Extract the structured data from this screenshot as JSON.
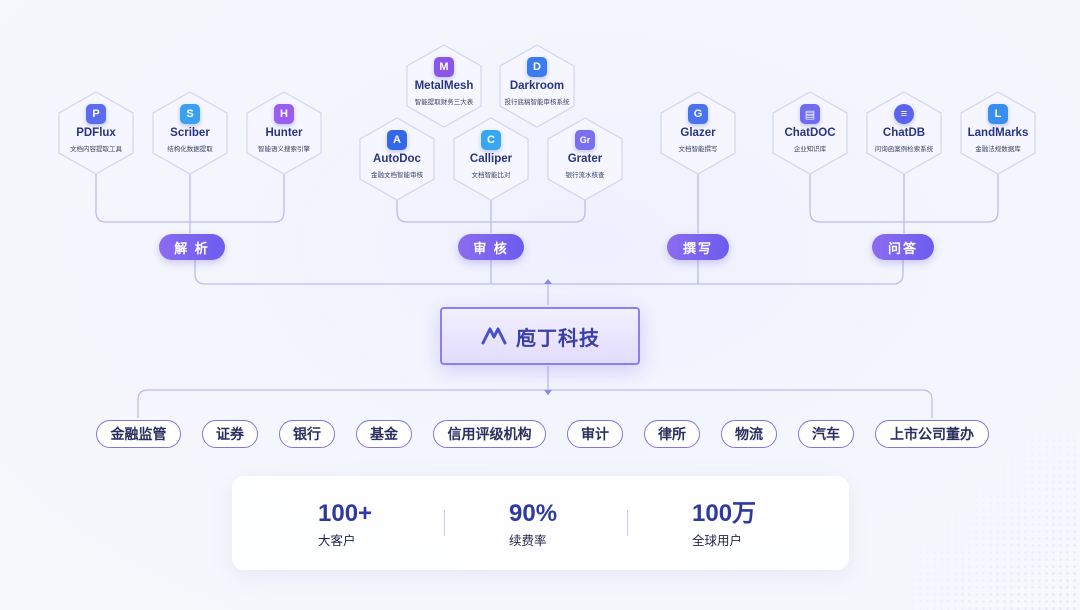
{
  "company": {
    "name": "庖丁科技",
    "logo_icon": "paodin-logo-icon"
  },
  "categories": [
    {
      "id": "parse",
      "label": "解 析"
    },
    {
      "id": "review",
      "label": "审 核"
    },
    {
      "id": "write",
      "label": "撰写"
    },
    {
      "id": "qa",
      "label": "问答"
    }
  ],
  "products": {
    "pdflux": {
      "letter": "P",
      "name": "PDFlux",
      "desc": "文档内容提取工具",
      "color": "#5b6cf0"
    },
    "scriber": {
      "letter": "S",
      "name": "Scriber",
      "desc": "结构化数据提取",
      "color": "#3aa0f0"
    },
    "hunter": {
      "letter": "H",
      "name": "Hunter",
      "desc": "智能语义搜索引擎",
      "color": "#9c5cf0"
    },
    "metalmesh": {
      "letter": "M",
      "name": "MetalMesh",
      "desc": "智能提取财务三大表",
      "color": "#8a56e8"
    },
    "darkroom": {
      "letter": "D",
      "name": "Darkroom",
      "desc": "投行底稿智能审核系统",
      "color": "#3a7cf0"
    },
    "autodoc": {
      "letter": "A",
      "name": "AutoDoc",
      "desc": "金融文档智能审核",
      "color": "#3568e8"
    },
    "calliper": {
      "letter": "C",
      "name": "Calliper",
      "desc": "文档智能比对",
      "color": "#39a6f2"
    },
    "grater": {
      "letter": "Gr",
      "name": "Grater",
      "desc": "银行流水核查",
      "color": "#7a6ff0"
    },
    "glazer": {
      "letter": "G",
      "name": "Glazer",
      "desc": "文档智能撰写",
      "color": "#4a74ee"
    },
    "chatdoc": {
      "letter": "▤",
      "name": "ChatDOC",
      "desc": "企业知识库",
      "color": "#6f6cf0"
    },
    "chatdb": {
      "letter": "≡",
      "name": "ChatDB",
      "desc": "问询函案例检索系统",
      "color": "#5a63ee"
    },
    "landmarks": {
      "letter": "L",
      "name": "LandMarks",
      "desc": "金融法规数据库",
      "color": "#3a8ef0"
    }
  },
  "industries": [
    "金融监管",
    "证券",
    "银行",
    "基金",
    "信用评级机构",
    "审计",
    "律所",
    "物流",
    "汽车",
    "上市公司董办"
  ],
  "stats": [
    {
      "value": "100+",
      "label": "大客户"
    },
    {
      "value": "90%",
      "label": "续费率"
    },
    {
      "value": "100万",
      "label": "全球用户"
    }
  ],
  "colors": {
    "accent": "#6d5cef",
    "line": "#b9b7ee",
    "text_dark": "#2a3580"
  }
}
